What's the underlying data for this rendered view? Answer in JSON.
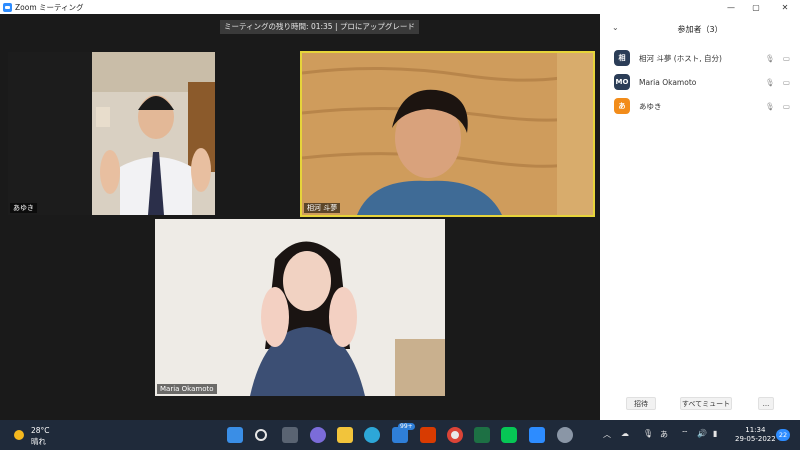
{
  "window": {
    "title": "Zoom ミーティング"
  },
  "meeting": {
    "timer_text": "ミーティングの残り時間: 01:35 | プロにアップグレード"
  },
  "tiles": [
    {
      "name": "あゆき"
    },
    {
      "name": "相河 斗夢"
    },
    {
      "name": "Maria Okamoto"
    }
  ],
  "panel": {
    "title": "参加者（3）",
    "participants": [
      {
        "avatar": "相",
        "name": "相河 斗夢 (ホスト, 自分)",
        "color": "#2b3d57"
      },
      {
        "avatar": "MO",
        "name": "Maria Okamoto",
        "color": "#2b3d57"
      },
      {
        "avatar": "あ",
        "name": "あゆき",
        "color": "#f28c1a"
      }
    ],
    "buttons": {
      "invite": "招待",
      "mute_all": "すべてミュート",
      "more": "..."
    }
  },
  "taskbar": {
    "weather_temp": "28°C",
    "weather_desc": "晴れ",
    "mail_badge": "99+",
    "ime": "あ",
    "time": "11:34",
    "date": "29-05-2022",
    "notification_count": "22"
  }
}
